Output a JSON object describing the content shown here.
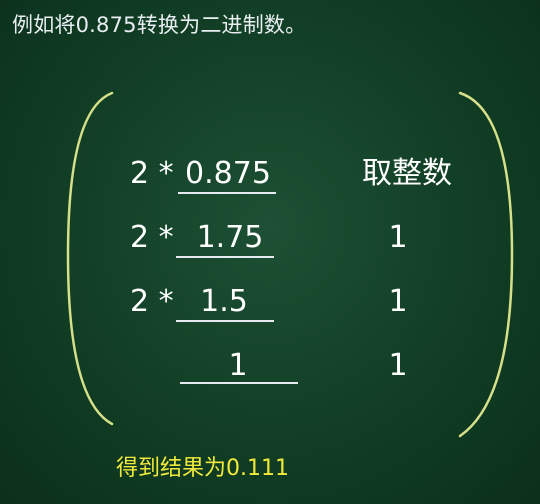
{
  "title": "例如将0.875转换为二进制数。",
  "header": "取整数",
  "rows": [
    {
      "multiplier": "2 *",
      "operand": "0.875",
      "digit": ""
    },
    {
      "multiplier": "2 *",
      "operand": "1.75",
      "digit": "1"
    },
    {
      "multiplier": "2 *",
      "operand": "1.5",
      "digit": "1"
    },
    {
      "multiplier": "",
      "operand": "1",
      "digit": "1"
    }
  ],
  "result": "得到结果为0.111",
  "colors": {
    "background": "#113e25",
    "text": "#ffffff",
    "bracket": "#d6e08a",
    "result": "#f2ea3a"
  }
}
